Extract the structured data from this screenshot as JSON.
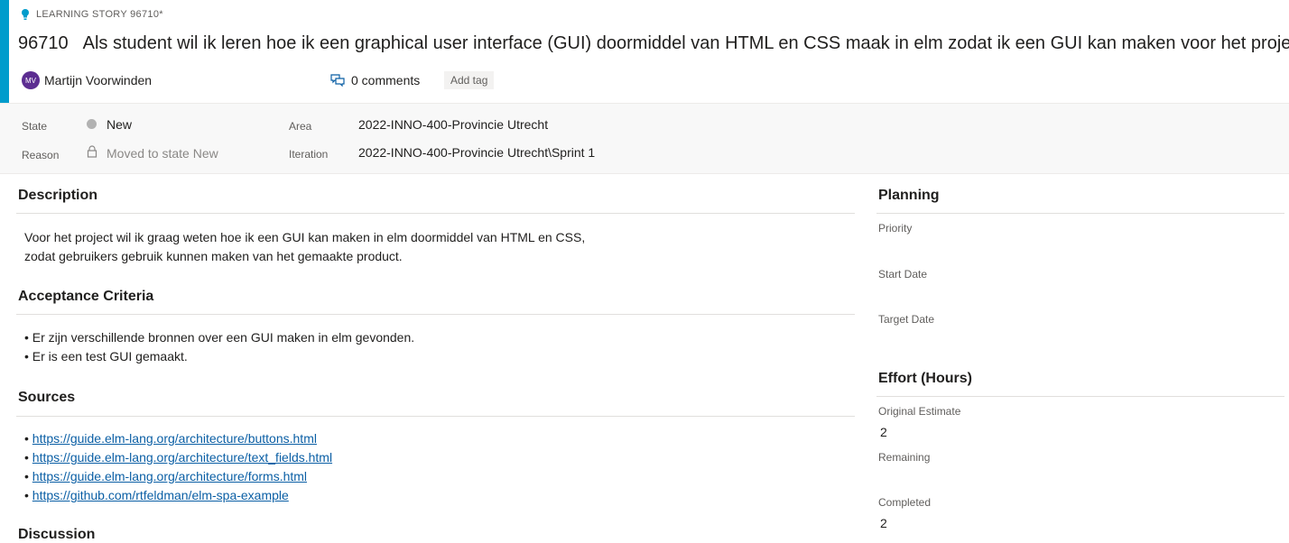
{
  "colors": {
    "accent": "#009ccc",
    "avatar_bg": "#5c2d91",
    "link": "#0b5fa5",
    "state_dot": "#b2b2b2"
  },
  "header": {
    "type_icon": "lightbulb-icon",
    "type_label": "LEARNING STORY 96710*",
    "id": "96710",
    "title": "Als student wil ik leren hoe ik een graphical user interface (GUI) doormiddel van HTML en CSS maak in elm zodat ik een GUI kan maken voor het project.",
    "avatar_initials": "MV",
    "assignee": "Martijn Voorwinden",
    "comments_icon": "comments-icon",
    "comments": "0 comments",
    "add_tag": "Add tag"
  },
  "fields": {
    "state_label": "State",
    "state_value": "New",
    "reason_label": "Reason",
    "reason_value": "Moved to state New",
    "area_label": "Area",
    "area_value": "2022-INNO-400-Provincie Utrecht",
    "iteration_label": "Iteration",
    "iteration_value": "2022-INNO-400-Provincie Utrecht\\Sprint 1"
  },
  "description": {
    "title": "Description",
    "lines": [
      "Voor het project wil ik graag weten hoe ik een GUI kan maken in elm doormiddel van HTML en CSS,",
      "zodat gebruikers gebruik kunnen maken van het gemaakte product."
    ]
  },
  "acceptance": {
    "title": "Acceptance Criteria",
    "items": [
      "Er zijn verschillende bronnen over een GUI maken in elm gevonden.",
      "Er is een test GUI gemaakt."
    ]
  },
  "sources": {
    "title": "Sources",
    "links": [
      "https://guide.elm-lang.org/architecture/buttons.html",
      "https://guide.elm-lang.org/architecture/text_fields.html",
      "https://guide.elm-lang.org/architecture/forms.html",
      "https://github.com/rtfeldman/elm-spa-example"
    ]
  },
  "discussion": {
    "title": "Discussion"
  },
  "planning": {
    "title": "Planning",
    "priority_label": "Priority",
    "start_date_label": "Start Date",
    "target_date_label": "Target Date"
  },
  "effort": {
    "title": "Effort (Hours)",
    "original_estimate_label": "Original Estimate",
    "original_estimate_value": "2",
    "remaining_label": "Remaining",
    "completed_label": "Completed",
    "completed_value": "2"
  }
}
